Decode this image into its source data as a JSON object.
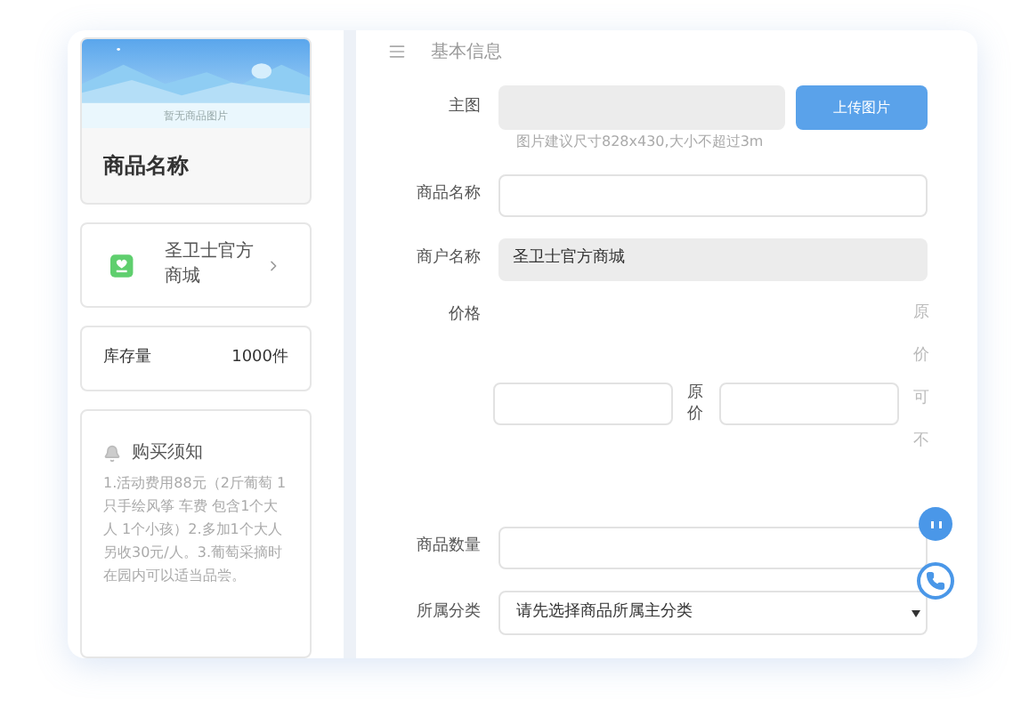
{
  "preview": {
    "image_caption": "暂无商品图片",
    "title": "商品名称"
  },
  "merchant": {
    "name": "圣卫士官方商城"
  },
  "stock": {
    "label": "库存量",
    "value": "1000件"
  },
  "notice": {
    "title": "购买须知",
    "text": "1.活动费用88元（2斤葡萄 1只手绘风筝 车费 包含1个大人 1个小孩）2.多加1个大人另收30元/人。3.葡萄采摘时在园内可以适当品尝。"
  },
  "section": {
    "title": "基本信息"
  },
  "form": {
    "rows": [
      {
        "kind": "upload",
        "label": "主图",
        "button": "上传图片",
        "hint": "图片建议尺寸828x430,大小不超过3m"
      },
      {
        "kind": "input",
        "label": "商品名称"
      },
      {
        "kind": "readonly",
        "label": "商户名称",
        "value": "圣卫士官方商城"
      },
      {
        "kind": "price",
        "label": "价格",
        "between": "原价",
        "note": "原价可不"
      },
      {
        "kind": "input",
        "label": "商品数量"
      },
      {
        "kind": "select",
        "label": "所属分类",
        "value": "请先选择商品所属主分类"
      }
    ]
  }
}
